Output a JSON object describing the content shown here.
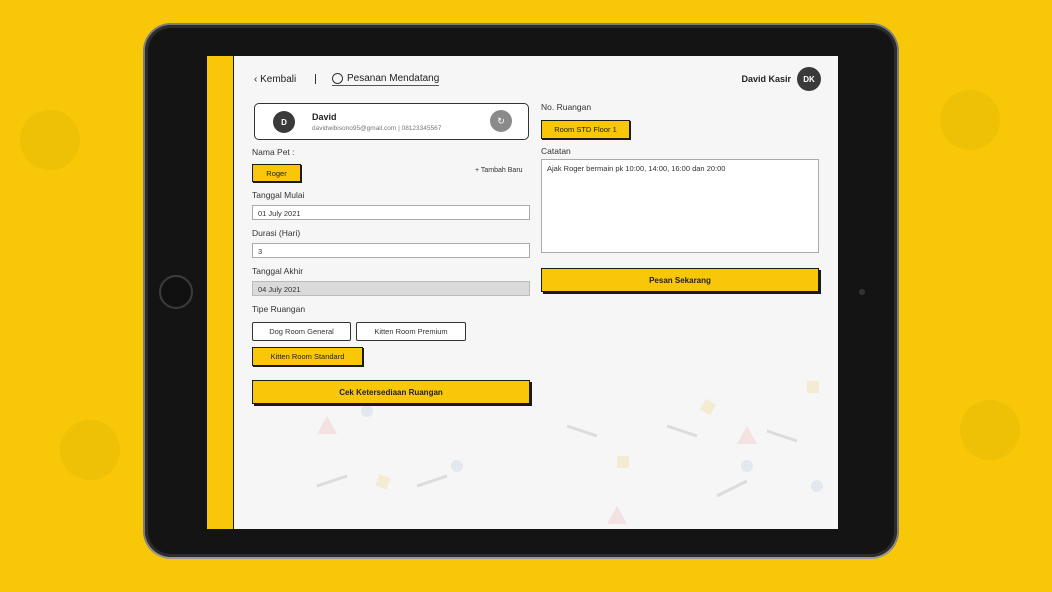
{
  "topbar": {
    "back_label": "Kembali",
    "back_icon": "chevron-left-icon",
    "page_title": "Pesanan Mendatang",
    "page_icon": "clock-icon",
    "user_name": "David Kasir",
    "user_initials": "DK"
  },
  "customer": {
    "initial": "D",
    "name": "David",
    "info": "davidwibisono95@gmail.com | 08123345567",
    "reset_icon": "refresh-icon"
  },
  "form": {
    "pet_label": "Nama Pet :",
    "pet_selected": "Roger",
    "add_new_label": "+ Tambah Baru",
    "start_date_label": "Tanggal Mulai",
    "start_date_value": "01 July 2021",
    "duration_label": "Durasi (Hari)",
    "duration_value": "3",
    "end_date_label": "Tanggal Akhir",
    "end_date_value": "04 July 2021",
    "room_type_label": "Tipe Ruangan",
    "room_types": [
      "Dog Room General",
      "Kitten Room Premium",
      "Kitten Room Standard"
    ],
    "check_button": "Cek Ketersediaan Ruangan"
  },
  "right": {
    "room_no_label": "No. Ruangan",
    "room_no_value": "Room STD Floor 1",
    "notes_label": "Catatan",
    "notes_value": "Ajak Roger bermain pk 10:00, 14:00, 16:00 dan 20:00",
    "order_button": "Pesan Sekarang"
  },
  "colors": {
    "accent": "#f7c708",
    "dark": "#141414"
  }
}
